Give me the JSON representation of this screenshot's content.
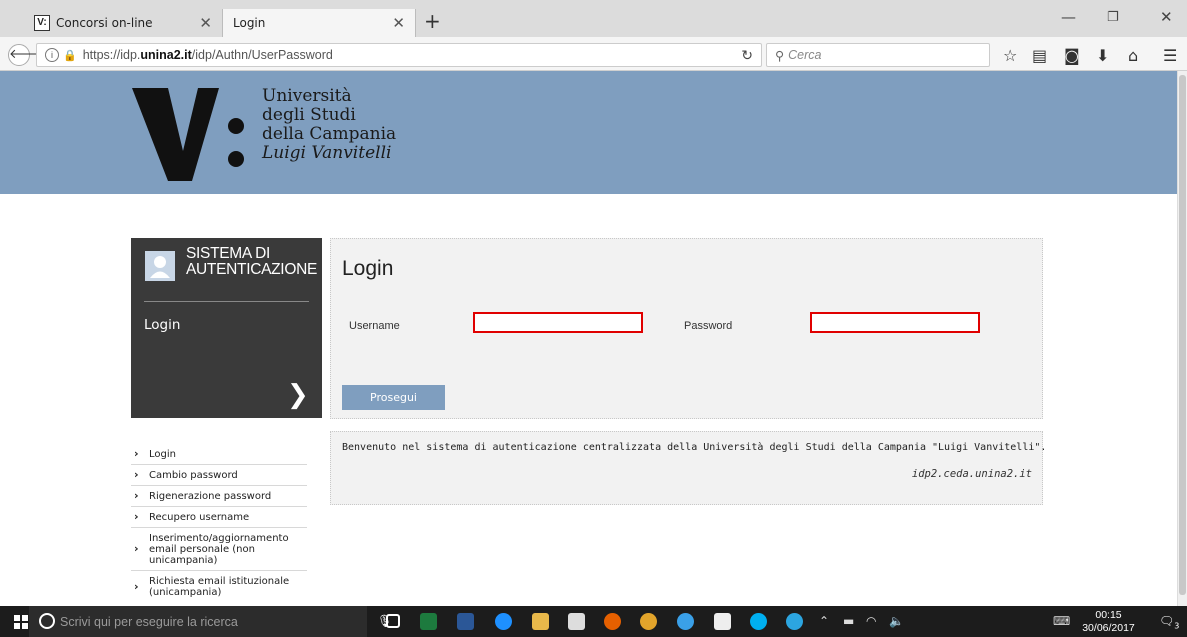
{
  "browser": {
    "tabs": [
      {
        "favicon": "V:",
        "label": "Concorsi on-line",
        "active": false
      },
      {
        "favicon": "",
        "label": "Login",
        "active": true
      }
    ],
    "url_prefix": "https://idp.",
    "url_domain": "unina2.it",
    "url_path": "/idp/Authn/UserPassword",
    "search_placeholder": "Cerca",
    "window_controls": [
      "minimize-icon",
      "restore-icon",
      "close-icon"
    ],
    "toolbar_icons": [
      "bookmark-star-icon",
      "reading-list-icon",
      "pocket-icon",
      "download-icon",
      "home-icon",
      "menu-icon"
    ]
  },
  "header": {
    "logo_mark": "V:",
    "logo_lines": [
      "Università",
      "degli Studi",
      "della Campania",
      "Luigi Vanvitelli"
    ]
  },
  "sidebar": {
    "panel_title_line1": "SISTEMA DI",
    "panel_title_line2": "AUTENTICAZIONE",
    "current_page": "Login",
    "menu": [
      "Login",
      "Cambio password",
      "Rigenerazione password",
      "Recupero username",
      "Inserimento/aggiornamento email personale (non unicampania)",
      "Richiesta email istituzionale (unicampania)"
    ]
  },
  "login": {
    "title": "Login",
    "username_label": "Username",
    "username_value": "",
    "password_label": "Password",
    "password_value": "",
    "submit_label": "Prosegui"
  },
  "welcome": {
    "message": "Benvenuto nel sistema di autenticazione centralizzata della Università degli Studi della Campania \"Luigi Vanvitelli\".",
    "host": "idp2.ceda.unina2.it"
  },
  "taskbar": {
    "search_placeholder": "Scrivi qui per eseguire la ricerca",
    "time": "00:15",
    "date": "30/06/2017",
    "notification_count": "3"
  }
}
